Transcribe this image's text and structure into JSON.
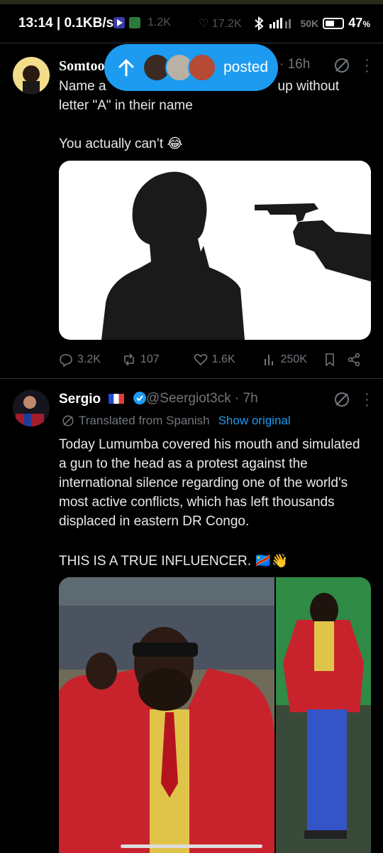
{
  "status_bar": {
    "time": "13:14",
    "speed": "0.1KB/s",
    "battery": "47",
    "faded_left": "1.2K",
    "faded_mid": "17.2K",
    "faded_right": "50K"
  },
  "posted_pill": {
    "label": "posted"
  },
  "tweet1": {
    "author_name": "Somtoo",
    "time": "· 16h",
    "text_line1": "Name a",
    "text_line1_end": "up without",
    "text_line2": "letter \"A\" in their name",
    "text_line3": "You actually can’t 😂",
    "replies": "3.2K",
    "reposts": "107",
    "likes": "1.6K",
    "views": "250K"
  },
  "tweet2": {
    "author_name": "Sergio",
    "handle": "@Seergiot3ck",
    "time": "· 7h",
    "translated_label": "Translated from Spanish",
    "show_original": "Show original",
    "text": "Today Lumumba covered his mouth and simulated a gun to the head as a protest against the international silence regarding one of the world's most active conflicts, which has left thousands displaced in eastern DR Congo.",
    "text2": "THIS IS A TRUE INFLUENCER. 🇨🇩👋"
  },
  "colors": {
    "background": "#000000",
    "accent": "#1d9bf0",
    "secondary_text": "#71767b",
    "verified": "#1d9bf0"
  }
}
